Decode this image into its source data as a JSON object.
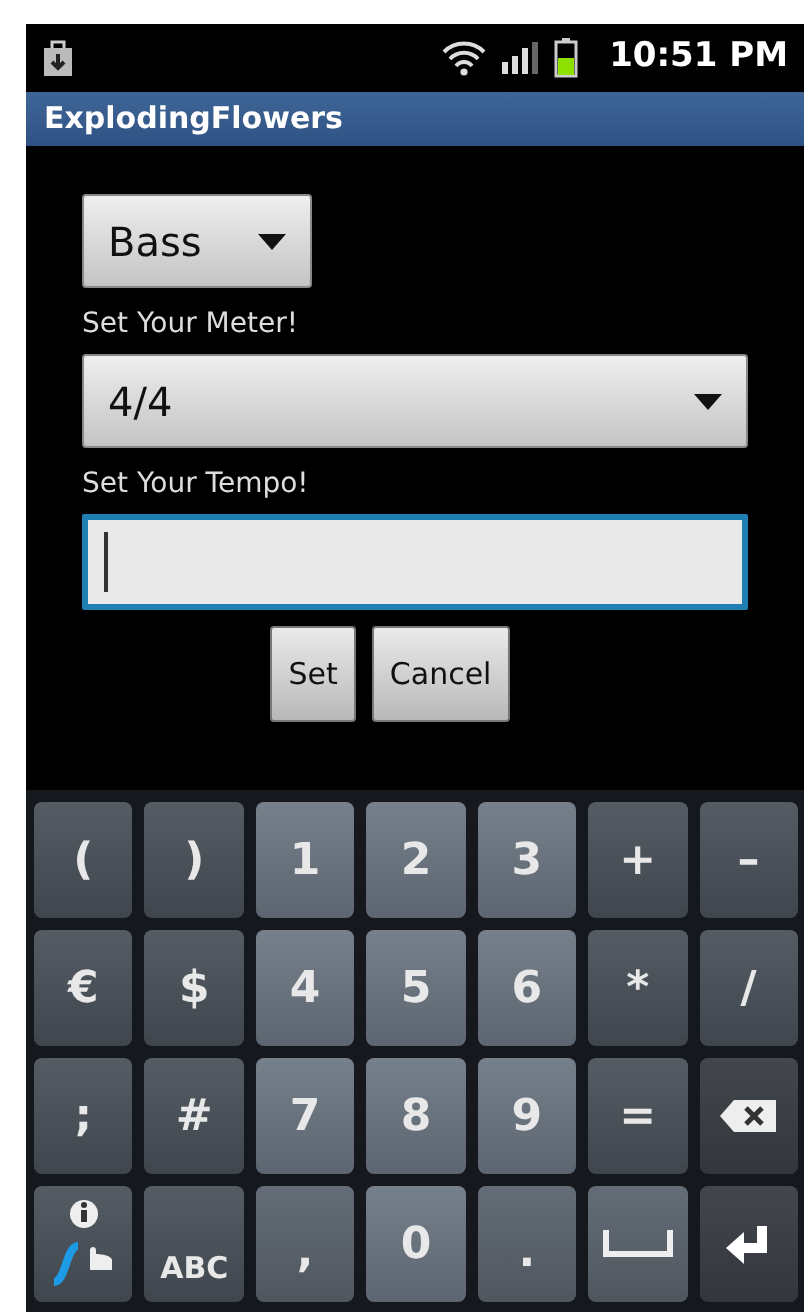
{
  "status_bar": {
    "time": "10:51 PM"
  },
  "app_bar": {
    "title": "ExplodingFlowers"
  },
  "form": {
    "clef": {
      "value": "Bass"
    },
    "meter": {
      "label": "Set Your Meter!",
      "value": "4/4"
    },
    "tempo": {
      "label": "Set Your Tempo!",
      "focused": true
    },
    "buttons": [
      "Set",
      "Cancel"
    ]
  },
  "keyboard": {
    "rows": [
      [
        {
          "kind": "symbol",
          "label": "("
        },
        {
          "kind": "symbol",
          "label": ")"
        },
        {
          "kind": "digit",
          "label": "1"
        },
        {
          "kind": "digit",
          "label": "2"
        },
        {
          "kind": "digit",
          "label": "3"
        },
        {
          "kind": "symbol",
          "label": "+"
        },
        {
          "kind": "symbol",
          "label": "–"
        }
      ],
      [
        {
          "kind": "symbol",
          "label": "€"
        },
        {
          "kind": "symbol",
          "label": "$"
        },
        {
          "kind": "digit",
          "label": "4"
        },
        {
          "kind": "digit",
          "label": "5"
        },
        {
          "kind": "digit",
          "label": "6"
        },
        {
          "kind": "symbol",
          "label": "*"
        },
        {
          "kind": "symbol",
          "label": "/"
        }
      ],
      [
        {
          "kind": "symbol",
          "label": ";"
        },
        {
          "kind": "symbol",
          "label": "#"
        },
        {
          "kind": "digit",
          "label": "7"
        },
        {
          "kind": "digit",
          "label": "8"
        },
        {
          "kind": "digit",
          "label": "9"
        },
        {
          "kind": "symbol",
          "label": "="
        },
        {
          "kind": "backspace"
        }
      ],
      [
        {
          "kind": "swype"
        },
        {
          "kind": "mode",
          "label": "ABC"
        },
        {
          "kind": "punct",
          "label": ","
        },
        {
          "kind": "digit",
          "label": "0"
        },
        {
          "kind": "punct",
          "label": "."
        },
        {
          "kind": "space"
        },
        {
          "kind": "enter"
        }
      ]
    ]
  }
}
